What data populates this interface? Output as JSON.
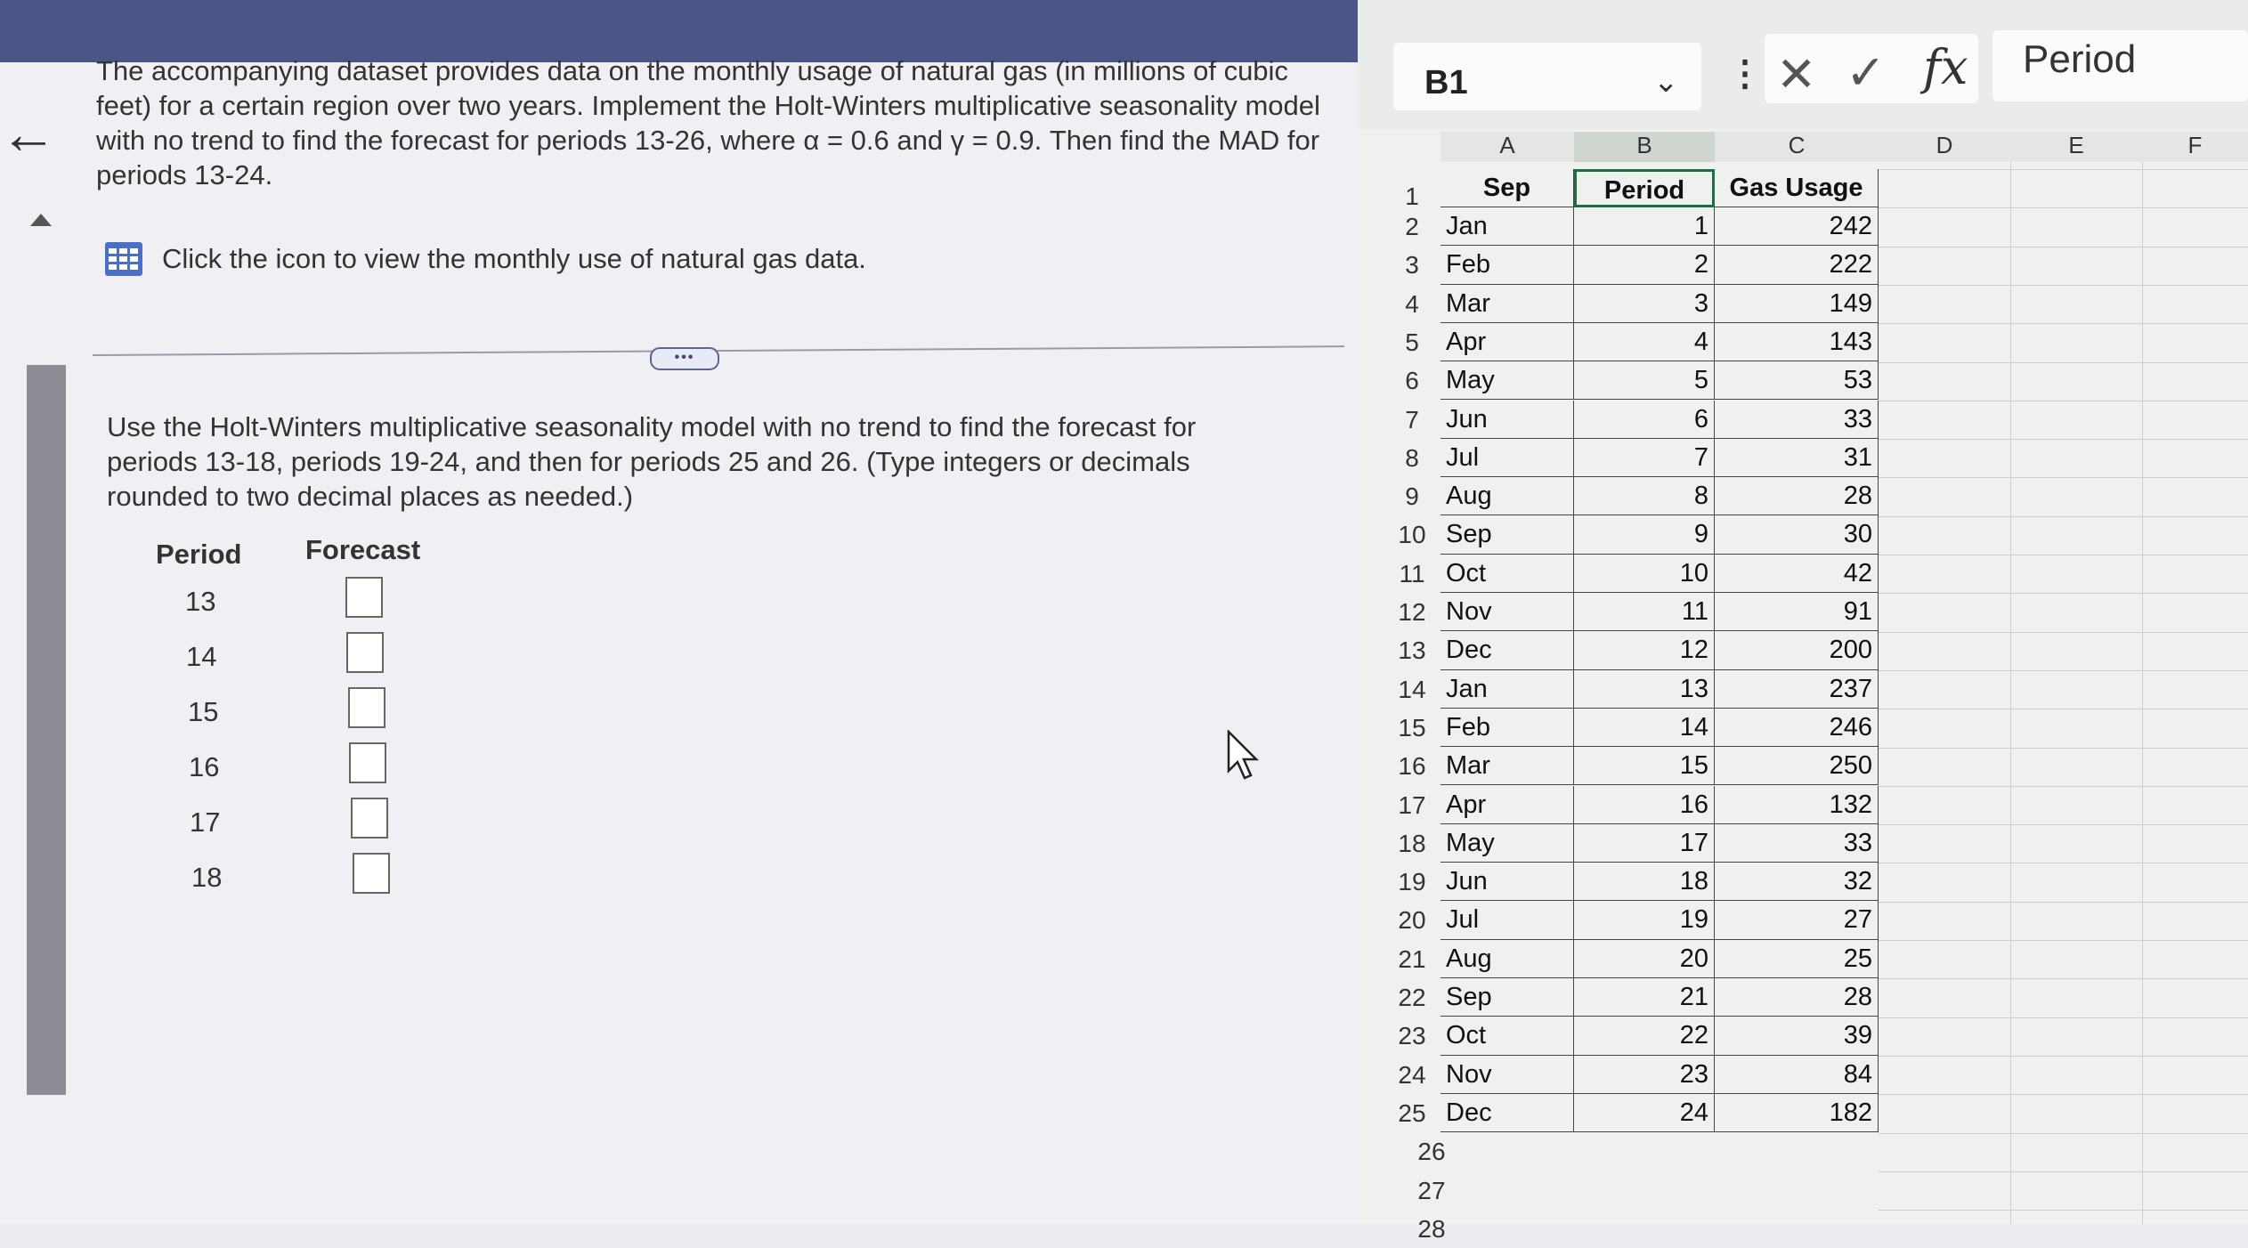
{
  "problem": {
    "text": "The accompanying dataset provides data on the monthly usage of natural gas (in millions of cubic feet) for a certain region over two years. Implement the Holt-Winters multiplicative seasonality model with no trend to find the forecast for periods 13-26, where α = 0.6 and γ = 0.9. Then find the MAD for periods 13-24.",
    "data_link": "Click the icon to view the monthly use of natural gas data.",
    "more_label": "•••"
  },
  "instructions": {
    "text": "Use the Holt-Winters multiplicative seasonality model with no trend to find the forecast for periods 13-18, periods 19-24, and then for periods 25 and 26. (Type integers or decimals rounded to two decimal places as needed.)"
  },
  "answer_table": {
    "period_header": "Period",
    "forecast_header": "Forecast",
    "periods": [
      "13",
      "14",
      "15",
      "16",
      "17",
      "18"
    ]
  },
  "spreadsheet": {
    "name_box": "B1",
    "formula_value": "Period",
    "fx_label": "fx",
    "columns": [
      "A",
      "B",
      "C",
      "D",
      "E",
      "F"
    ],
    "headers": [
      "Sep",
      "Period",
      "Gas Usage"
    ],
    "rows": [
      {
        "num": "2",
        "month": "Jan",
        "period": "1",
        "usage": "242"
      },
      {
        "num": "3",
        "month": "Feb",
        "period": "2",
        "usage": "222"
      },
      {
        "num": "4",
        "month": "Mar",
        "period": "3",
        "usage": "149"
      },
      {
        "num": "5",
        "month": "Apr",
        "period": "4",
        "usage": "143"
      },
      {
        "num": "6",
        "month": "May",
        "period": "5",
        "usage": "53"
      },
      {
        "num": "7",
        "month": "Jun",
        "period": "6",
        "usage": "33"
      },
      {
        "num": "8",
        "month": "Jul",
        "period": "7",
        "usage": "31"
      },
      {
        "num": "9",
        "month": "Aug",
        "period": "8",
        "usage": "28"
      },
      {
        "num": "10",
        "month": "Sep",
        "period": "9",
        "usage": "30"
      },
      {
        "num": "11",
        "month": "Oct",
        "period": "10",
        "usage": "42"
      },
      {
        "num": "12",
        "month": "Nov",
        "period": "11",
        "usage": "91"
      },
      {
        "num": "13",
        "month": "Dec",
        "period": "12",
        "usage": "200"
      },
      {
        "num": "14",
        "month": "Jan",
        "period": "13",
        "usage": "237"
      },
      {
        "num": "15",
        "month": "Feb",
        "period": "14",
        "usage": "246"
      },
      {
        "num": "16",
        "month": "Mar",
        "period": "15",
        "usage": "250"
      },
      {
        "num": "17",
        "month": "Apr",
        "period": "16",
        "usage": "132"
      },
      {
        "num": "18",
        "month": "May",
        "period": "17",
        "usage": "33"
      },
      {
        "num": "19",
        "month": "Jun",
        "period": "18",
        "usage": "32"
      },
      {
        "num": "20",
        "month": "Jul",
        "period": "19",
        "usage": "27"
      },
      {
        "num": "21",
        "month": "Aug",
        "period": "20",
        "usage": "25"
      },
      {
        "num": "22",
        "month": "Sep",
        "period": "21",
        "usage": "28"
      },
      {
        "num": "23",
        "month": "Oct",
        "period": "22",
        "usage": "39"
      },
      {
        "num": "24",
        "month": "Nov",
        "period": "23",
        "usage": "84"
      },
      {
        "num": "25",
        "month": "Dec",
        "period": "24",
        "usage": "182"
      }
    ],
    "extra_rows": [
      "26",
      "27",
      "28"
    ]
  }
}
